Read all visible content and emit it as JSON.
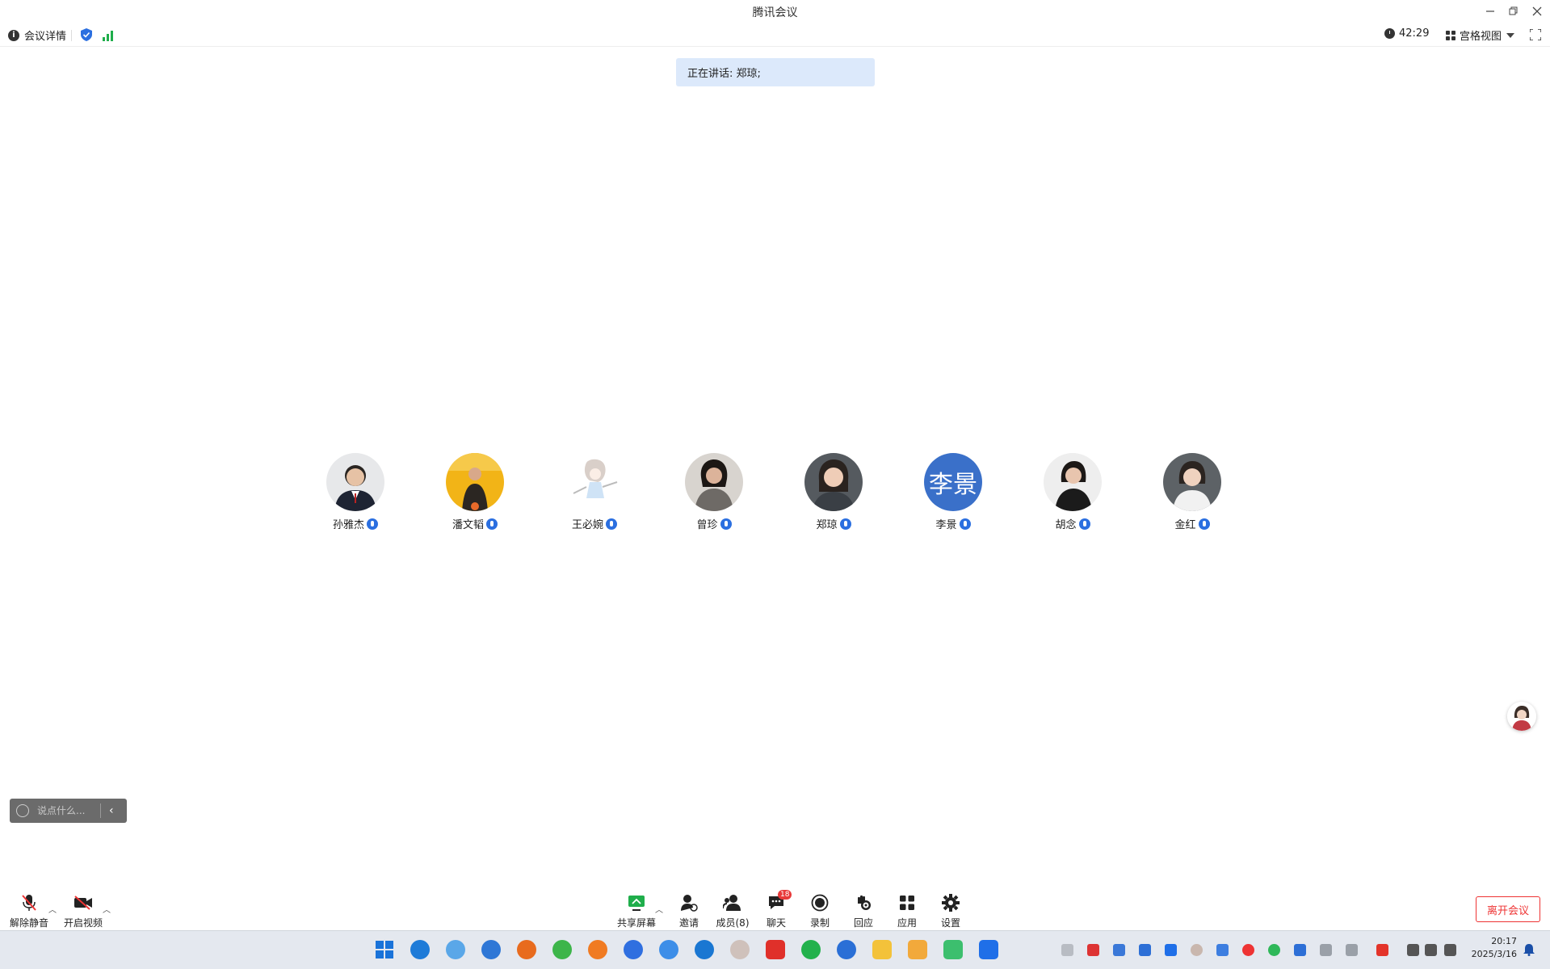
{
  "window": {
    "title": "腾讯会议",
    "controls": [
      "minimize",
      "restore",
      "close"
    ]
  },
  "infobar": {
    "meeting_details": "会议详情",
    "timer": "42:29",
    "view_mode": "宫格视图"
  },
  "speaking": {
    "text": "正在讲话: 郑琼;"
  },
  "participants": [
    {
      "name": "孙雅杰"
    },
    {
      "name": "潘文韬"
    },
    {
      "name": "王必婉"
    },
    {
      "name": "曾珍"
    },
    {
      "name": "郑琼"
    },
    {
      "name": "李景",
      "initials": "李景"
    },
    {
      "name": "胡念"
    },
    {
      "name": "金红"
    }
  ],
  "chat": {
    "placeholder": "说点什么..."
  },
  "toolbar": {
    "unmute": "解除静音",
    "start_video": "开启视频",
    "share_screen": "共享屏幕",
    "invite": "邀请",
    "members": "成员(8)",
    "chat": "聊天",
    "chat_badge": "18",
    "record": "录制",
    "reactions": "回应",
    "apps": "应用",
    "settings": "设置",
    "leave": "离开会议"
  },
  "taskbar": {
    "time": "20:17",
    "date": "2025/3/16"
  },
  "colors": {
    "accent": "#2b6fe0",
    "leave": "#e33333",
    "banner": "#dce9fb"
  }
}
